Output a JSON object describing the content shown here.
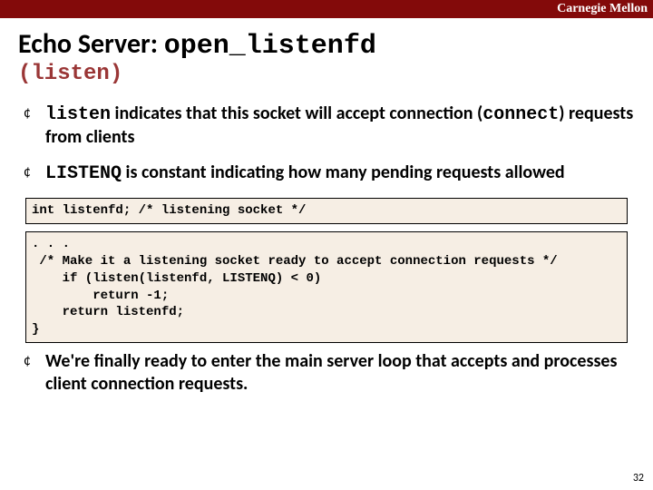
{
  "header": {
    "label": "Carnegie Mellon"
  },
  "title": {
    "prefix": "Echo Server: ",
    "funcname": "open_listenfd"
  },
  "subtitle": "(listen)",
  "bullets": {
    "b1": {
      "mono1": "listen",
      "t1": " indicates that this socket will accept connection (",
      "mono2": "connect",
      "t2": ") requests from clients"
    },
    "b2": {
      "mono1": "LISTENQ",
      "t1": " is constant indicating how many pending requests allowed"
    },
    "b3": {
      "t1": "We're finally ready to enter the main server loop that accepts and processes client connection requests."
    }
  },
  "code1": "int listenfd; /* listening socket */",
  "code2": ". . .\n /* Make it a listening socket ready to accept connection requests */\n    if (listen(listenfd, LISTENQ) < 0)\n        return -1;\n    return listenfd;\n}",
  "page_number": "32"
}
